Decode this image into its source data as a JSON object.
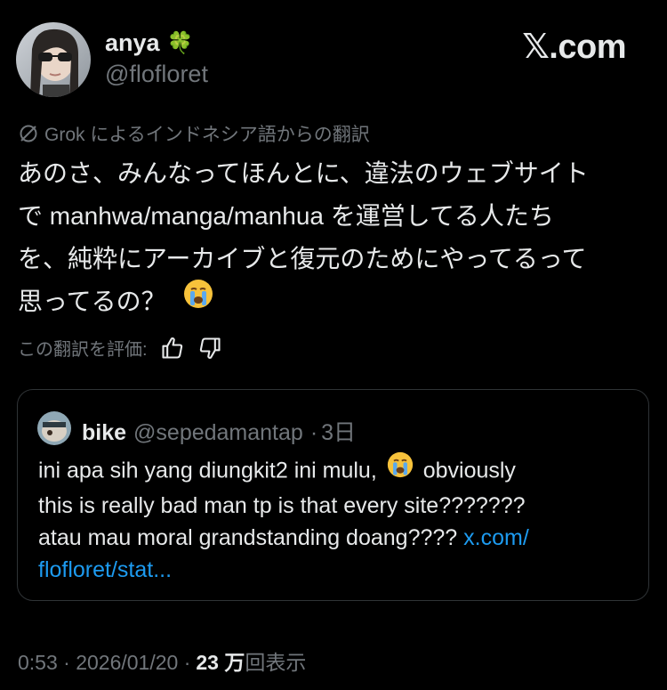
{
  "author": {
    "display_name": "anya",
    "name_emoji": "🍀",
    "handle": "@flofloret"
  },
  "brand": {
    "logo_text": "𝕏.com"
  },
  "translation": {
    "label": "Grok によるインドネシア語からの翻訳"
  },
  "tweet": {
    "lines": [
      "あのさ、みんなってほんとに、違法のウェブサイト",
      "で manhwa/manga/manhua を運営してる人たち",
      "を、純粋にアーカイブと復元のためにやってるって",
      "思ってるの？"
    ]
  },
  "rating": {
    "label": "この翻訳を評価:"
  },
  "quote": {
    "name": "bike",
    "handle": "@sepedamantap",
    "separator": "·",
    "time": "3日",
    "line1": "ini apa sih yang diungkit2 ini mulu,",
    "line1b": "obviously",
    "line2": "this is really bad man tp is that every site???????",
    "line3": "atau mau moral grandstanding doang????",
    "link_part1": "x.com/",
    "link_part2": "flofloret/stat..."
  },
  "meta": {
    "time": "0:53 · 2026/01/20 ·",
    "views_number": "23 万",
    "views_suffix": "回表示"
  },
  "colors": {
    "background": "#000000",
    "text": "#e7e9ea",
    "muted": "#71767b",
    "link": "#1d9bf0",
    "border": "#2f3336"
  }
}
